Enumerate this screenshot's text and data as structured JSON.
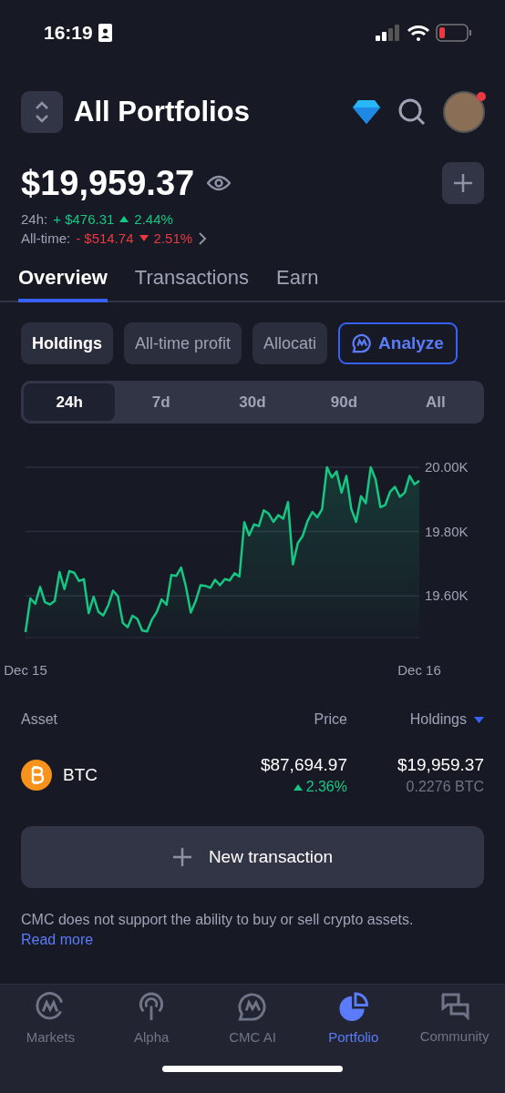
{
  "status_bar": {
    "time": "16:19"
  },
  "header": {
    "title": "All Portfolios"
  },
  "balance": {
    "value": "$19,959.37"
  },
  "changes": [
    {
      "label": "24h:",
      "amount": "+ $476.31",
      "percent": "2.44%",
      "kind": "up"
    },
    {
      "label": "All-time:",
      "amount": "- $514.74",
      "percent": "2.51%",
      "kind": "down"
    }
  ],
  "tabs": [
    {
      "label": "Overview",
      "selected": true
    },
    {
      "label": "Transactions",
      "selected": false
    },
    {
      "label": "Earn",
      "selected": false
    }
  ],
  "chips": [
    {
      "label": "Holdings",
      "selected": true
    },
    {
      "label": "All-time profit",
      "selected": false
    },
    {
      "label": "Allocati",
      "selected": false
    }
  ],
  "analyze_button": {
    "label": "Analyze"
  },
  "periods": [
    {
      "label": "24h",
      "selected": true
    },
    {
      "label": "7d",
      "selected": false
    },
    {
      "label": "30d",
      "selected": false
    },
    {
      "label": "90d",
      "selected": false
    },
    {
      "label": "All",
      "selected": false
    }
  ],
  "chart_data": {
    "type": "area",
    "categories": [
      "Dec 15",
      null,
      null,
      null,
      null,
      null,
      null,
      null,
      null,
      null,
      null,
      null,
      null,
      null,
      null,
      null,
      null,
      null,
      null,
      null,
      null,
      null,
      null,
      null,
      null,
      null,
      null,
      null,
      null,
      null,
      null,
      null,
      null,
      null,
      null,
      null,
      null,
      null,
      null,
      null,
      null,
      null,
      null,
      null,
      null,
      null,
      null,
      null,
      null,
      null,
      null,
      null,
      null,
      null,
      null,
      null,
      null,
      null,
      null,
      null,
      null,
      null,
      null,
      null,
      null,
      null,
      null,
      null,
      null,
      null,
      null,
      null,
      null,
      null,
      null,
      null,
      null,
      null,
      null,
      null,
      null,
      "Dec 16"
    ],
    "grid": true,
    "ylim": [
      19470,
      20000
    ],
    "yticks": [
      {
        "value": 19600,
        "label": "19.60K"
      },
      {
        "value": 19800,
        "label": "19.80K"
      },
      {
        "value": 20000,
        "label": "20.00K"
      }
    ],
    "series": [
      {
        "color": "#16c784",
        "values": [
          19487,
          19592,
          19575,
          19628,
          19580,
          19573,
          19584,
          19674,
          19621,
          19677,
          19672,
          19646,
          19652,
          19546,
          19597,
          19550,
          19539,
          19570,
          19616,
          19599,
          19516,
          19502,
          19538,
          19528,
          19492,
          19489,
          19526,
          19550,
          19589,
          19572,
          19665,
          19662,
          19688,
          19628,
          19548,
          19584,
          19633,
          19631,
          19625,
          19650,
          19633,
          19652,
          19648,
          19670,
          19660,
          19829,
          19788,
          19822,
          19817,
          19866,
          19856,
          19830,
          19851,
          19840,
          19892,
          19698,
          19764,
          19786,
          19832,
          19861,
          19844,
          19869,
          20000,
          19968,
          19987,
          19921,
          19973,
          19871,
          19830,
          19910,
          19888,
          20000,
          19963,
          19876,
          19883,
          19924,
          19939,
          19908,
          19921,
          19973,
          19947,
          19958
        ]
      }
    ]
  },
  "table": {
    "columns": [
      {
        "label": "Asset"
      },
      {
        "label": "Price"
      },
      {
        "label": "Holdings",
        "sorted": true
      }
    ],
    "rows": [
      {
        "symbol": "BTC",
        "price": "$87,694.97",
        "change": "2.36%",
        "kind": "up",
        "value": "$19,959.37",
        "amount": "0.2276 BTC"
      }
    ]
  },
  "new_transaction_button": {
    "label": "New transaction"
  },
  "disclaimer": {
    "text": "CMC does not support the ability to buy or sell crypto assets.",
    "link": "Read more"
  },
  "nav": [
    {
      "label": "Markets",
      "selected": false
    },
    {
      "label": "Alpha",
      "selected": false
    },
    {
      "label": "CMC AI",
      "selected": false
    },
    {
      "label": "Portfolio",
      "selected": true
    },
    {
      "label": "Community",
      "selected": false
    }
  ]
}
